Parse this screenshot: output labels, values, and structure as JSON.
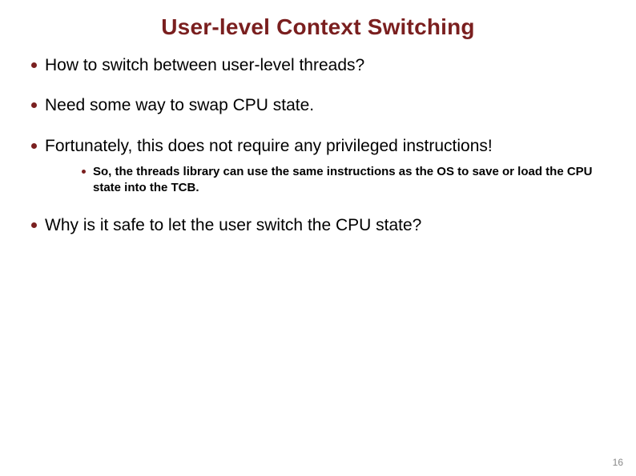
{
  "title": "User-level Context Switching",
  "bullets": [
    {
      "text": "How to switch between user-level threads?"
    },
    {
      "text": "Need some way to swap CPU state."
    },
    {
      "text": "Fortunately, this does not require any privileged instructions!",
      "sub": [
        "So, the threads library can use the same instructions as the OS to save or load the CPU state into the TCB."
      ]
    },
    {
      "text": "Why is it safe to let the user switch the CPU state?"
    }
  ],
  "page_number": "16"
}
